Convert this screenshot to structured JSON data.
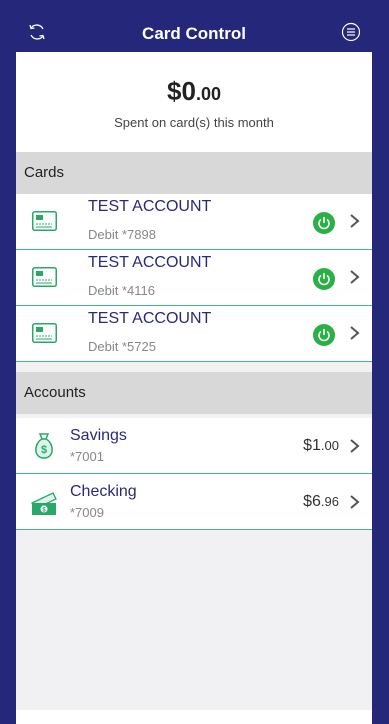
{
  "header": {
    "title": "Card Control",
    "left_icon": "refresh-icon",
    "right_icon": "menu-icon"
  },
  "summary": {
    "amount_main": "$0",
    "amount_cents": ".00",
    "label": "Spent on card(s) this month"
  },
  "cards_section": {
    "label": "Cards"
  },
  "cards": [
    {
      "name": "TEST ACCOUNT",
      "subtitle": "Debit *7898",
      "power_on": true
    },
    {
      "name": "TEST ACCOUNT",
      "subtitle": "Debit *4116",
      "power_on": true
    },
    {
      "name": "TEST ACCOUNT",
      "subtitle": "Debit *5725",
      "power_on": true
    }
  ],
  "accounts_section": {
    "label": "Accounts"
  },
  "accounts": [
    {
      "name": "Savings",
      "subtitle": "*7001",
      "balance_main": "$1",
      "balance_cents": ".00",
      "icon": "money-bag-icon"
    },
    {
      "name": "Checking",
      "subtitle": "*7009",
      "balance_main": "$6",
      "balance_cents": ".96",
      "icon": "cash-icon"
    }
  ],
  "colors": {
    "brand": "#25277a",
    "accent": "#4ab28e",
    "power_on": "#2ab047"
  }
}
